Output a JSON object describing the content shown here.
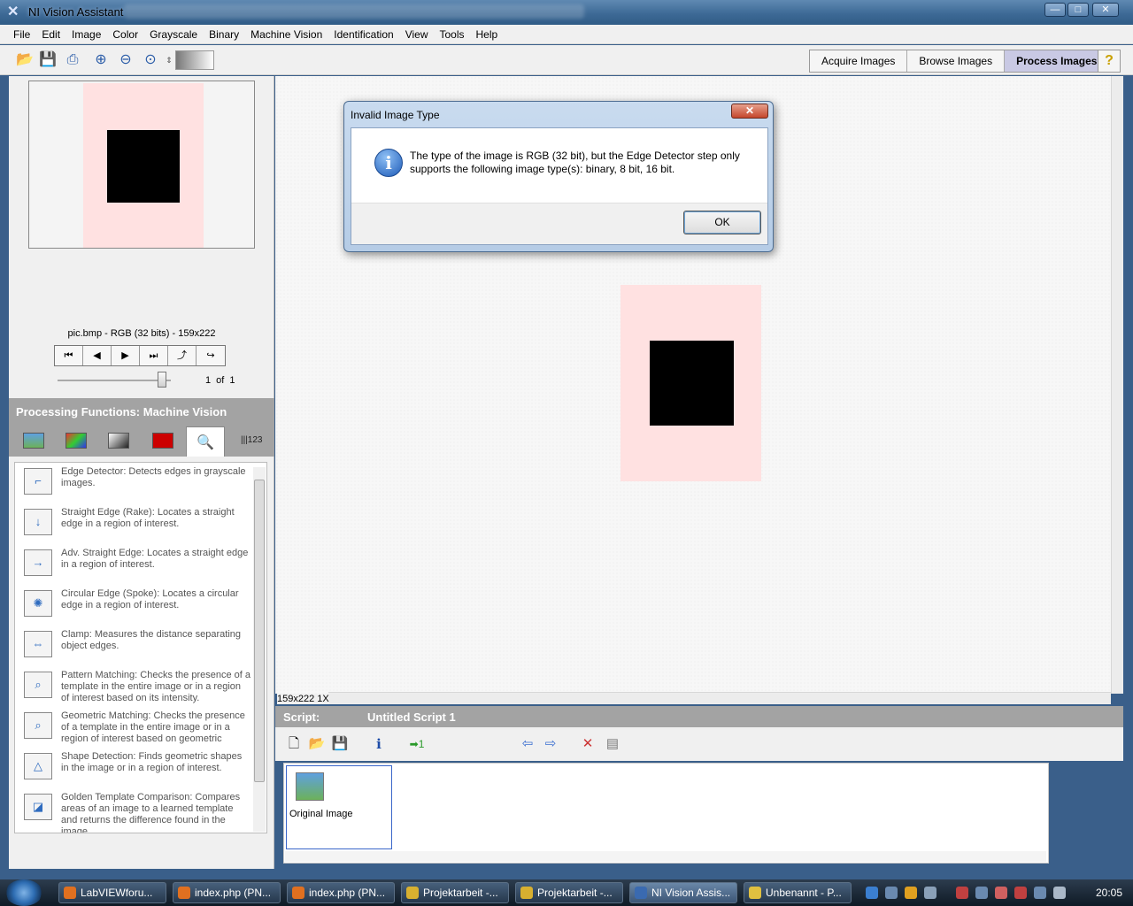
{
  "window": {
    "title": "NI Vision Assistant",
    "minimize": "—",
    "maximize": "□",
    "close": "✕"
  },
  "menu": [
    "File",
    "Edit",
    "Image",
    "Color",
    "Grayscale",
    "Binary",
    "Machine Vision",
    "Identification",
    "View",
    "Tools",
    "Help"
  ],
  "modes": {
    "acquire": "Acquire Images",
    "browse": "Browse Images",
    "process": "Process Images",
    "help": "?"
  },
  "image_browser": {
    "info": "pic.bmp - RGB (32 bits) - 159x222",
    "current": "1",
    "of_label": "of",
    "total": "1"
  },
  "processing": {
    "header": "Processing Functions: Machine Vision",
    "items": [
      {
        "label": "Edge Detector:  Detects edges in grayscale images."
      },
      {
        "label": "Straight Edge (Rake):  Locates a straight edge in a region of interest."
      },
      {
        "label": "Adv. Straight Edge:  Locates a straight edge in a region of interest."
      },
      {
        "label": "Circular Edge (Spoke):  Locates a circular edge in a region of interest."
      },
      {
        "label": "Clamp:  Measures the distance separating object edges."
      },
      {
        "label": "Pattern Matching:  Checks the presence of a template in the entire image or in a region of interest based on its intensity."
      },
      {
        "label": "Geometric Matching:  Checks the presence of a template in the entire image or in a region of interest based on geometric"
      },
      {
        "label": "Shape Detection:  Finds geometric shapes in the image or in a region of interest."
      },
      {
        "label": "Golden Template Comparison:  Compares areas of an image to a learned template and returns the difference found in the image."
      }
    ]
  },
  "canvas": {
    "size_label": "159x222 1X"
  },
  "script": {
    "label": "Script:",
    "name": "Untitled Script 1",
    "run_label": "1",
    "steps": [
      {
        "label": "Original Image"
      }
    ]
  },
  "dialog": {
    "title": "Invalid Image Type",
    "message": "The type of the image is RGB (32 bit), but the Edge Detector step only supports the following image type(s): binary, 8 bit, 16 bit.",
    "ok": "OK",
    "close": "✕"
  },
  "taskbar": {
    "tasks": [
      {
        "label": "LabVIEWforu..."
      },
      {
        "label": "index.php (PN..."
      },
      {
        "label": "index.php (PN..."
      },
      {
        "label": "Projektarbeit -..."
      },
      {
        "label": "Projektarbeit -..."
      },
      {
        "label": "NI Vision Assis..."
      },
      {
        "label": "Unbenannt - P..."
      }
    ],
    "clock": "20:05"
  }
}
